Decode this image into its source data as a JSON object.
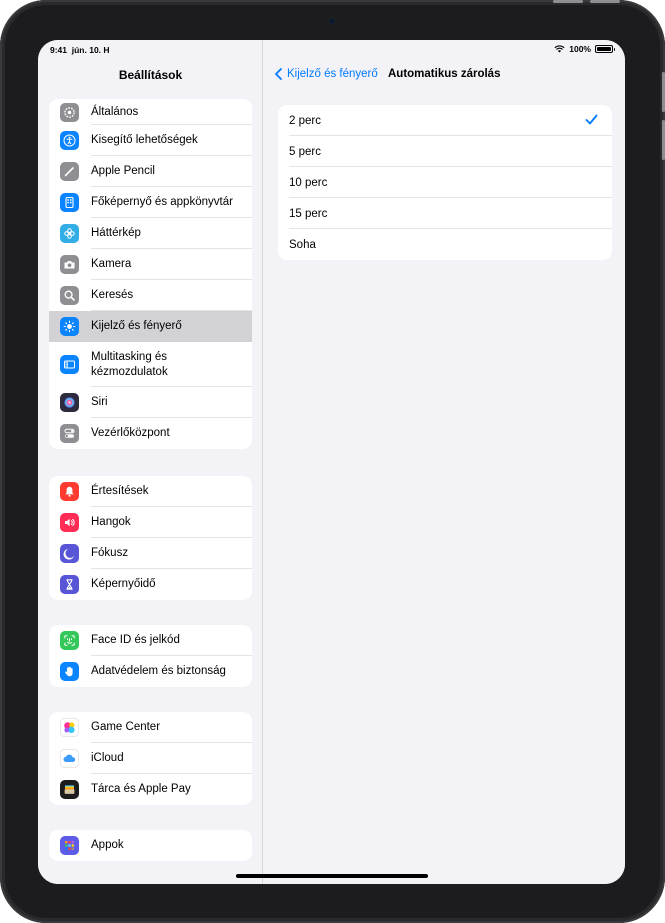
{
  "status_bar": {
    "time": "9:41",
    "date": "jún. 10. H",
    "battery": "100%"
  },
  "sidebar": {
    "title": "Beállítások",
    "groups": [
      {
        "items": [
          {
            "label": "Általános",
            "icon": "gear-icon",
            "color": "#8e8e93"
          },
          {
            "label": "Kisegítő lehetőségek",
            "icon": "accessibility-icon",
            "color": "#0a84ff"
          },
          {
            "label": "Apple Pencil",
            "icon": "pencil-icon",
            "color": "#8e8e93"
          },
          {
            "label": "Főképernyő és appkönyvtár",
            "icon": "home-screen-icon",
            "color": "#0a84ff"
          },
          {
            "label": "Háttérkép",
            "icon": "flower-icon",
            "color": "#32ade6"
          },
          {
            "label": "Kamera",
            "icon": "camera-icon",
            "color": "#8e8e93"
          },
          {
            "label": "Keresés",
            "icon": "search-icon",
            "color": "#8e8e93"
          },
          {
            "label": "Kijelző és fényerő",
            "icon": "sun-icon",
            "color": "#0a84ff",
            "selected": true
          },
          {
            "label": "Multitasking és kézmozdulatok",
            "icon": "multitasking-icon",
            "color": "#0a84ff"
          },
          {
            "label": "Siri",
            "icon": "siri-icon",
            "color": "#2c2c3e"
          },
          {
            "label": "Vezérlőközpont",
            "icon": "toggles-icon",
            "color": "#8e8e93"
          }
        ]
      },
      {
        "items": [
          {
            "label": "Értesítések",
            "icon": "bell-icon",
            "color": "#ff3b30"
          },
          {
            "label": "Hangok",
            "icon": "speaker-icon",
            "color": "#ff2d55"
          },
          {
            "label": "Fókusz",
            "icon": "moon-icon",
            "color": "#5856d6"
          },
          {
            "label": "Képernyőidő",
            "icon": "hourglass-icon",
            "color": "#5856d6"
          }
        ]
      },
      {
        "items": [
          {
            "label": "Face ID és jelkód",
            "icon": "face-id-icon",
            "color": "#34c759"
          },
          {
            "label": "Adatvédelem és biztonság",
            "icon": "hand-icon",
            "color": "#0a84ff"
          }
        ]
      },
      {
        "items": [
          {
            "label": "Game Center",
            "icon": "game-center-icon",
            "color": "#ffffff"
          },
          {
            "label": "iCloud",
            "icon": "cloud-icon",
            "color": "#ffffff"
          },
          {
            "label": "Tárca és Apple Pay",
            "icon": "wallet-icon",
            "color": "#1c1c1e"
          }
        ]
      },
      {
        "items": [
          {
            "label": "Appok",
            "icon": "apps-grid-icon",
            "color": "#5e5ce6"
          }
        ]
      }
    ]
  },
  "detail": {
    "back_label": "Kijelző és fényerő",
    "title": "Automatikus zárolás",
    "options": [
      {
        "label": "2 perc",
        "checked": true
      },
      {
        "label": "5 perc",
        "checked": false
      },
      {
        "label": "10 perc",
        "checked": false
      },
      {
        "label": "15 perc",
        "checked": false
      },
      {
        "label": "Soha",
        "checked": false
      }
    ]
  },
  "colors": {
    "accent": "#007aff",
    "selection": "#d1d1d6",
    "background": "#f2f2f7"
  }
}
